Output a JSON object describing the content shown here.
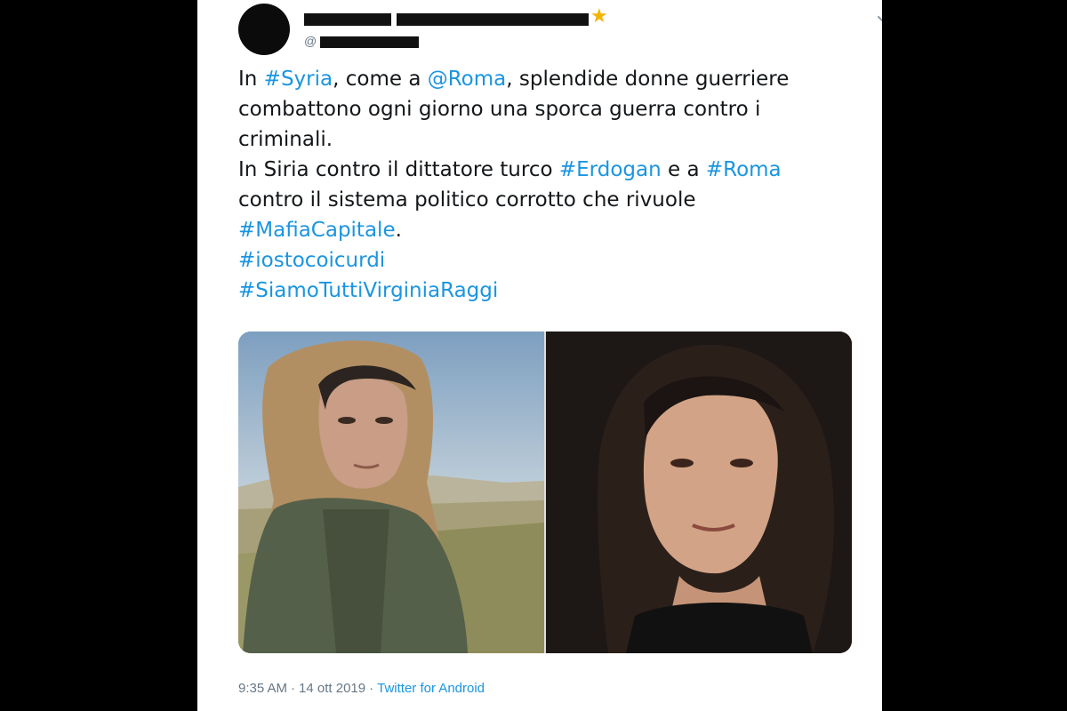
{
  "tweet": {
    "handle_prefix": "@",
    "verified_icon": "star-icon",
    "menu_icon": "chevron-down-icon",
    "text_lines": [
      [
        {
          "t": "In "
        },
        {
          "t": "#Syria",
          "link": true
        },
        {
          "t": ", come a "
        },
        {
          "t": "@Roma",
          "link": true
        },
        {
          "t": ", splendide donne guerriere"
        }
      ],
      [
        {
          "t": "combattono ogni giorno una sporca guerra contro i"
        }
      ],
      [
        {
          "t": "criminali."
        }
      ],
      [
        {
          "t": "In Siria contro il dittatore turco "
        },
        {
          "t": "#Erdogan",
          "link": true
        },
        {
          "t": " e a "
        },
        {
          "t": "#Roma",
          "link": true
        }
      ],
      [
        {
          "t": "contro il sistema politico corrotto che rivuole"
        }
      ],
      [
        {
          "t": "#MafiaCapitale",
          "link": true
        },
        {
          "t": "."
        }
      ],
      [
        {
          "t": "#iostocoicurdi",
          "link": true
        }
      ],
      [
        {
          "t": "#SiamoTuttiVirginiaRaggi",
          "link": true
        }
      ]
    ],
    "time": "9:35 AM",
    "date": "14 ott 2019",
    "separator": "·",
    "source": "Twitter for Android"
  },
  "colors": {
    "link": "#1b95e0",
    "text": "#14171a",
    "muted": "#657786",
    "background": "#000000",
    "card": "#ffffff"
  }
}
